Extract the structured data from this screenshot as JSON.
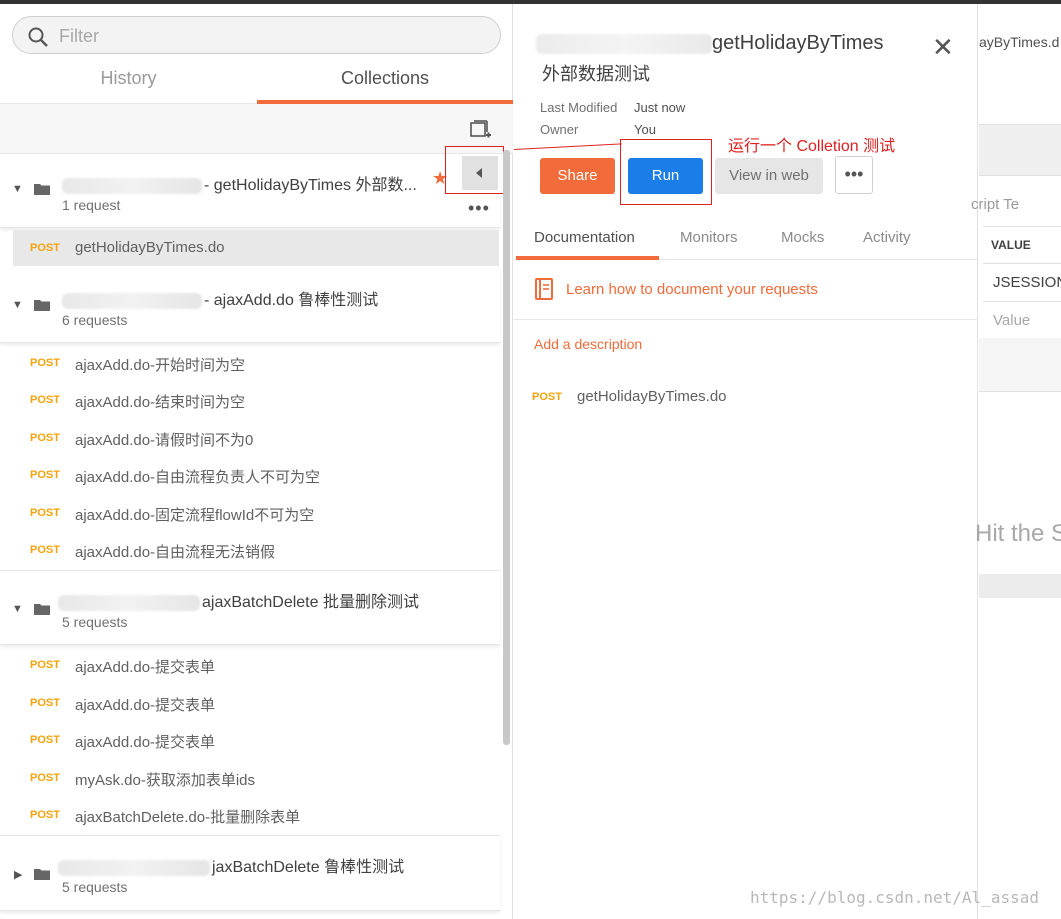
{
  "filter": {
    "placeholder": "Filter"
  },
  "tabs": {
    "history": "History",
    "collections": "Collections"
  },
  "collections": [
    {
      "name": "- getHolidayByTimes 外部数...",
      "count": "1 request",
      "requests": [
        {
          "method": "POST",
          "name": "getHolidayByTimes.do"
        }
      ]
    },
    {
      "name": "- ajaxAdd.do 鲁棒性测试",
      "count": "6 requests",
      "requests": [
        {
          "method": "POST",
          "name": "ajaxAdd.do-开始时间为空"
        },
        {
          "method": "POST",
          "name": "ajaxAdd.do-结束时间为空"
        },
        {
          "method": "POST",
          "name": "ajaxAdd.do-请假时间不为0"
        },
        {
          "method": "POST",
          "name": "ajaxAdd.do-自由流程负责人不可为空"
        },
        {
          "method": "POST",
          "name": "ajaxAdd.do-固定流程flowId不可为空"
        },
        {
          "method": "POST",
          "name": "ajaxAdd.do-自由流程无法销假"
        }
      ]
    },
    {
      "name": "ajaxBatchDelete 批量删除测试",
      "count": "5 requests",
      "requests": [
        {
          "method": "POST",
          "name": "ajaxAdd.do-提交表单"
        },
        {
          "method": "POST",
          "name": "ajaxAdd.do-提交表单"
        },
        {
          "method": "POST",
          "name": "ajaxAdd.do-提交表单"
        },
        {
          "method": "POST",
          "name": "myAsk.do-获取添加表单ids"
        },
        {
          "method": "POST",
          "name": "ajaxBatchDelete.do-批量删除表单"
        }
      ]
    },
    {
      "name": "jaxBatchDelete 鲁棒性测试",
      "count": "5 requests"
    }
  ],
  "detail": {
    "title": "getHolidayByTimes",
    "subtitle": "外部数据测试",
    "last_modified_label": "Last Modified",
    "last_modified_value": "Just now",
    "owner_label": "Owner",
    "owner_value": "You",
    "share": "Share",
    "run": "Run",
    "view_web": "View in web",
    "annotation": "运行一个 Colletion 测试",
    "tabs": [
      "Documentation",
      "Monitors",
      "Mocks",
      "Activity"
    ],
    "learn": "Learn how to document your requests",
    "add_description": "Add a description",
    "request": {
      "method": "POST",
      "name": "getHolidayByTimes.do"
    }
  },
  "background": {
    "tab": "ayByTimes.d",
    "tabs2": "cript Te",
    "value_header": "VALUE",
    "row1": "JSESSIONI",
    "row2": "Value",
    "hint": "Hit the S"
  },
  "watermark": "https://blog.csdn.net/Al_assad",
  "colors": {
    "accent": "#f26b3a",
    "run": "#1b7ee8",
    "post": "#f6a30a",
    "annotation": "#e02020"
  }
}
